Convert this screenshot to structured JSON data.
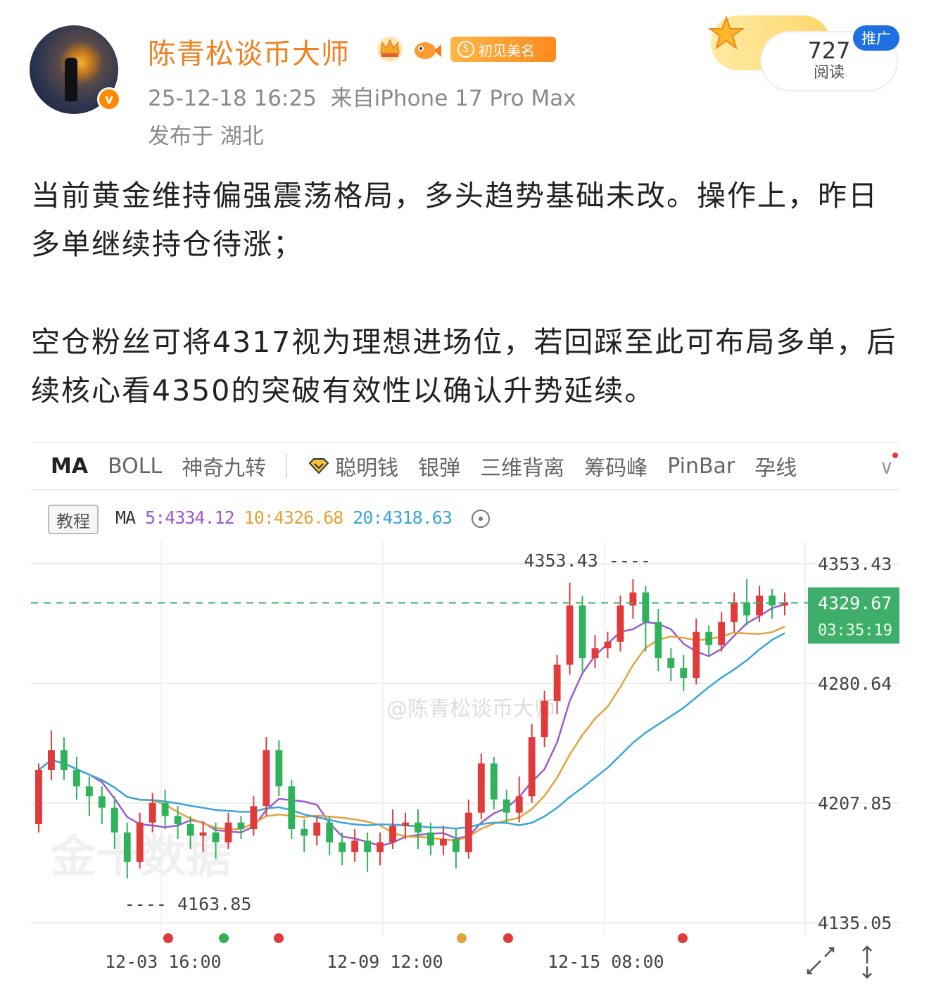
{
  "user": {
    "name": "陈青松谈币大师",
    "badge_level": "5",
    "badge_text": "初见美名",
    "time": "25-12-18 16:25",
    "source": "来自iPhone 17 Pro Max",
    "location": "发布于 湖北",
    "verified_mark": "v"
  },
  "stats": {
    "reads": "727",
    "reads_label": "阅读",
    "ad_label": "推广"
  },
  "post": {
    "paragraph1": "当前黄金维持偏强震荡格局，多头趋势基础未改。操作上，昨日多单继续持仓待涨；",
    "paragraph2": "空仓粉丝可将4317视为理想进场位，若回踩至此可布局多单，后续核心看4350的突破有效性以确认升势延续。"
  },
  "chart_toolbar": {
    "tabs": [
      "MA",
      "BOLL",
      "神奇九转",
      "聪明钱",
      "银弹",
      "三维背离",
      "筹码峰",
      "PinBar",
      "孕线"
    ],
    "tutorial_label": "教程",
    "ma_label": "MA",
    "ma5": "5:4334.12",
    "ma10": "10:4326.68",
    "ma20": "20:4318.63"
  },
  "chart_data": {
    "type": "candlestick",
    "y_ticks": [
      "4353.43",
      "4280.64",
      "4207.85",
      "4135.05"
    ],
    "current_price": "4329.67",
    "countdown": "03:35:19",
    "high_label": "4353.43",
    "low_label": "4163.85",
    "x_ticks": [
      "12-03 16:00",
      "12-09 12:00",
      "12-15 08:00"
    ],
    "watermark": "@陈青松谈币大师",
    "ylim": [
      4135.05,
      4353.43
    ],
    "colors": {
      "up": "#e03a3a",
      "down": "#2eb35a",
      "ma5": "#9b5bd0",
      "ma10": "#e6a23a",
      "ma20": "#3aa7d8",
      "price_tag": "#3fae6a"
    },
    "candles": [
      [
        4195,
        4228,
        4190,
        4232
      ],
      [
        4228,
        4240,
        4222,
        4252
      ],
      [
        4240,
        4228,
        4222,
        4248
      ],
      [
        4228,
        4218,
        4210,
        4236
      ],
      [
        4218,
        4212,
        4200,
        4224
      ],
      [
        4212,
        4205,
        4195,
        4218
      ],
      [
        4205,
        4190,
        4180,
        4212
      ],
      [
        4190,
        4172,
        4162,
        4196
      ],
      [
        4172,
        4196,
        4168,
        4202
      ],
      [
        4196,
        4208,
        4190,
        4214
      ],
      [
        4208,
        4200,
        4192,
        4216
      ],
      [
        4200,
        4195,
        4186,
        4206
      ],
      [
        4195,
        4188,
        4180,
        4200
      ],
      [
        4188,
        4190,
        4178,
        4196
      ],
      [
        4190,
        4184,
        4174,
        4196
      ],
      [
        4184,
        4196,
        4180,
        4202
      ],
      [
        4196,
        4192,
        4186,
        4200
      ],
      [
        4192,
        4206,
        4188,
        4212
      ],
      [
        4206,
        4240,
        4200,
        4248
      ],
      [
        4240,
        4218,
        4212,
        4246
      ],
      [
        4218,
        4192,
        4186,
        4222
      ],
      [
        4192,
        4188,
        4178,
        4198
      ],
      [
        4188,
        4196,
        4182,
        4200
      ],
      [
        4196,
        4184,
        4176,
        4200
      ],
      [
        4184,
        4178,
        4170,
        4190
      ],
      [
        4178,
        4185,
        4172,
        4192
      ],
      [
        4185,
        4178,
        4166,
        4190
      ],
      [
        4178,
        4184,
        4170,
        4190
      ],
      [
        4184,
        4194,
        4180,
        4204
      ],
      [
        4194,
        4196,
        4186,
        4202
      ],
      [
        4196,
        4190,
        4180,
        4204
      ],
      [
        4190,
        4182,
        4176,
        4196
      ],
      [
        4182,
        4186,
        4176,
        4194
      ],
      [
        4186,
        4178,
        4168,
        4192
      ],
      [
        4178,
        4202,
        4174,
        4210
      ],
      [
        4202,
        4232,
        4198,
        4238
      ],
      [
        4232,
        4210,
        4204,
        4236
      ],
      [
        4210,
        4202,
        4196,
        4216
      ],
      [
        4202,
        4212,
        4196,
        4224
      ],
      [
        4212,
        4248,
        4208,
        4256
      ],
      [
        4248,
        4270,
        4242,
        4276
      ],
      [
        4270,
        4292,
        4262,
        4298
      ],
      [
        4292,
        4328,
        4286,
        4342
      ],
      [
        4328,
        4296,
        4288,
        4334
      ],
      [
        4296,
        4302,
        4290,
        4310
      ],
      [
        4302,
        4306,
        4296,
        4312
      ],
      [
        4306,
        4328,
        4300,
        4334
      ],
      [
        4328,
        4336,
        4320,
        4344
      ],
      [
        4336,
        4318,
        4300,
        4340
      ],
      [
        4318,
        4296,
        4288,
        4326
      ],
      [
        4296,
        4290,
        4282,
        4302
      ],
      [
        4290,
        4284,
        4276,
        4298
      ],
      [
        4284,
        4312,
        4280,
        4320
      ],
      [
        4312,
        4304,
        4298,
        4316
      ],
      [
        4304,
        4318,
        4300,
        4324
      ],
      [
        4318,
        4330,
        4312,
        4336
      ],
      [
        4330,
        4322,
        4316,
        4344
      ],
      [
        4322,
        4334,
        4318,
        4340
      ],
      [
        4334,
        4328,
        4320,
        4338
      ],
      [
        4328,
        4330,
        4322,
        4336
      ]
    ]
  }
}
